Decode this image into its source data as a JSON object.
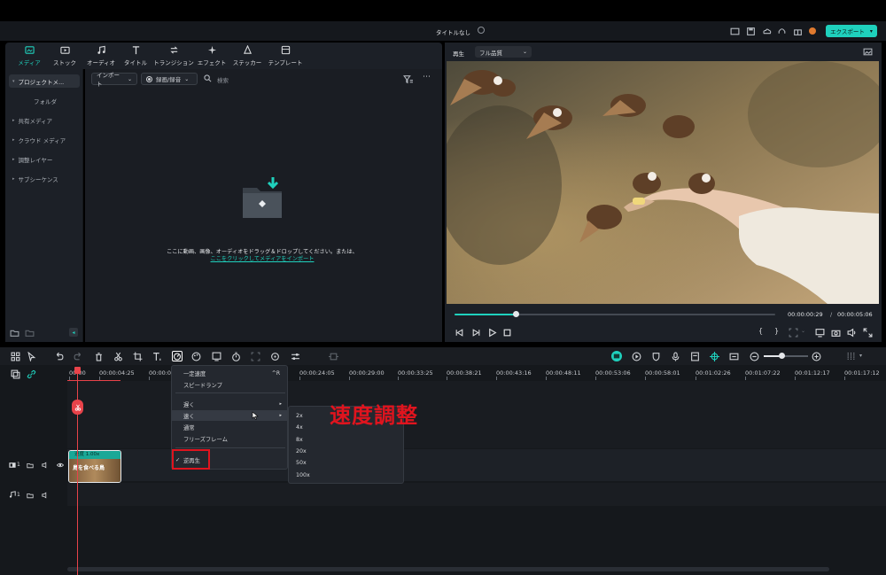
{
  "window": {
    "title": "タイトルなし",
    "export_label": "エクスポート",
    "export_arrow": "▾"
  },
  "media_tabs": [
    {
      "label": "メディア",
      "icon": "media-icon"
    },
    {
      "label": "ストック",
      "icon": "stock-icon"
    },
    {
      "label": "オーディオ",
      "icon": "music-note-icon"
    },
    {
      "label": "タイトル",
      "icon": "title-t-icon"
    },
    {
      "label": "トランジション",
      "icon": "transition-icon"
    },
    {
      "label": "エフェクト",
      "icon": "effect-sparkle-icon"
    },
    {
      "label": "ステッカー",
      "icon": "sticker-icon"
    },
    {
      "label": "テンプレート",
      "icon": "template-icon"
    }
  ],
  "sidebar": {
    "items": [
      {
        "label": "プロジェクトメ..."
      },
      {
        "label": "フォルダ"
      },
      {
        "label": "共有メディア"
      },
      {
        "label": "クラウド メディア"
      },
      {
        "label": "調整レイヤー"
      },
      {
        "label": "サブシーケンス"
      }
    ]
  },
  "media_toolbar": {
    "import_label": "インポート",
    "record_label": "録画/録音",
    "search_placeholder": "検索"
  },
  "media_empty": {
    "line1": "ここに動画、画像、オーディオをドラッグ＆ドロップしてください。または、",
    "link": "ここをクリックしてメディアをインポート"
  },
  "preview": {
    "mode_label": "再生",
    "quality": "フル品質",
    "current_time": "00:00:00:29",
    "separator": "/",
    "total_time": "00:00:05:06",
    "progress": 0.19
  },
  "ruler": {
    "times": [
      "00:00",
      "00:00:04:25",
      "00:00:0",
      "00:00:24:05",
      "00:00:29:00",
      "00:00:33:25",
      "00:00:38:21",
      "00:00:43:16",
      "00:00:48:11",
      "00:00:53:06",
      "00:00:58:01",
      "00:01:02:26",
      "00:01:07:22",
      "00:01:12:17",
      "00:01:17:12"
    ]
  },
  "context_menu": {
    "items": [
      "一定速度",
      "スピードランプ",
      "遅く",
      "速く",
      "通常",
      "フリーズフレーム",
      "逆再生"
    ],
    "shortcut": "^R",
    "checked_mark": "✓"
  },
  "speed_submenu": {
    "items": [
      "2x",
      "4x",
      "8x",
      "20x",
      "50x",
      "100x"
    ]
  },
  "annotation": {
    "text": "速度調整",
    "color": "#e0141e"
  },
  "clip": {
    "badge": "速度 1.00x",
    "title": "鳥を食べる鳥"
  },
  "tracks": {
    "video_index": "1",
    "audio_index": "1"
  },
  "colors": {
    "accent": "#1fd1bd",
    "playhead": "#e8434a",
    "highlight_box": "#e0141e"
  }
}
